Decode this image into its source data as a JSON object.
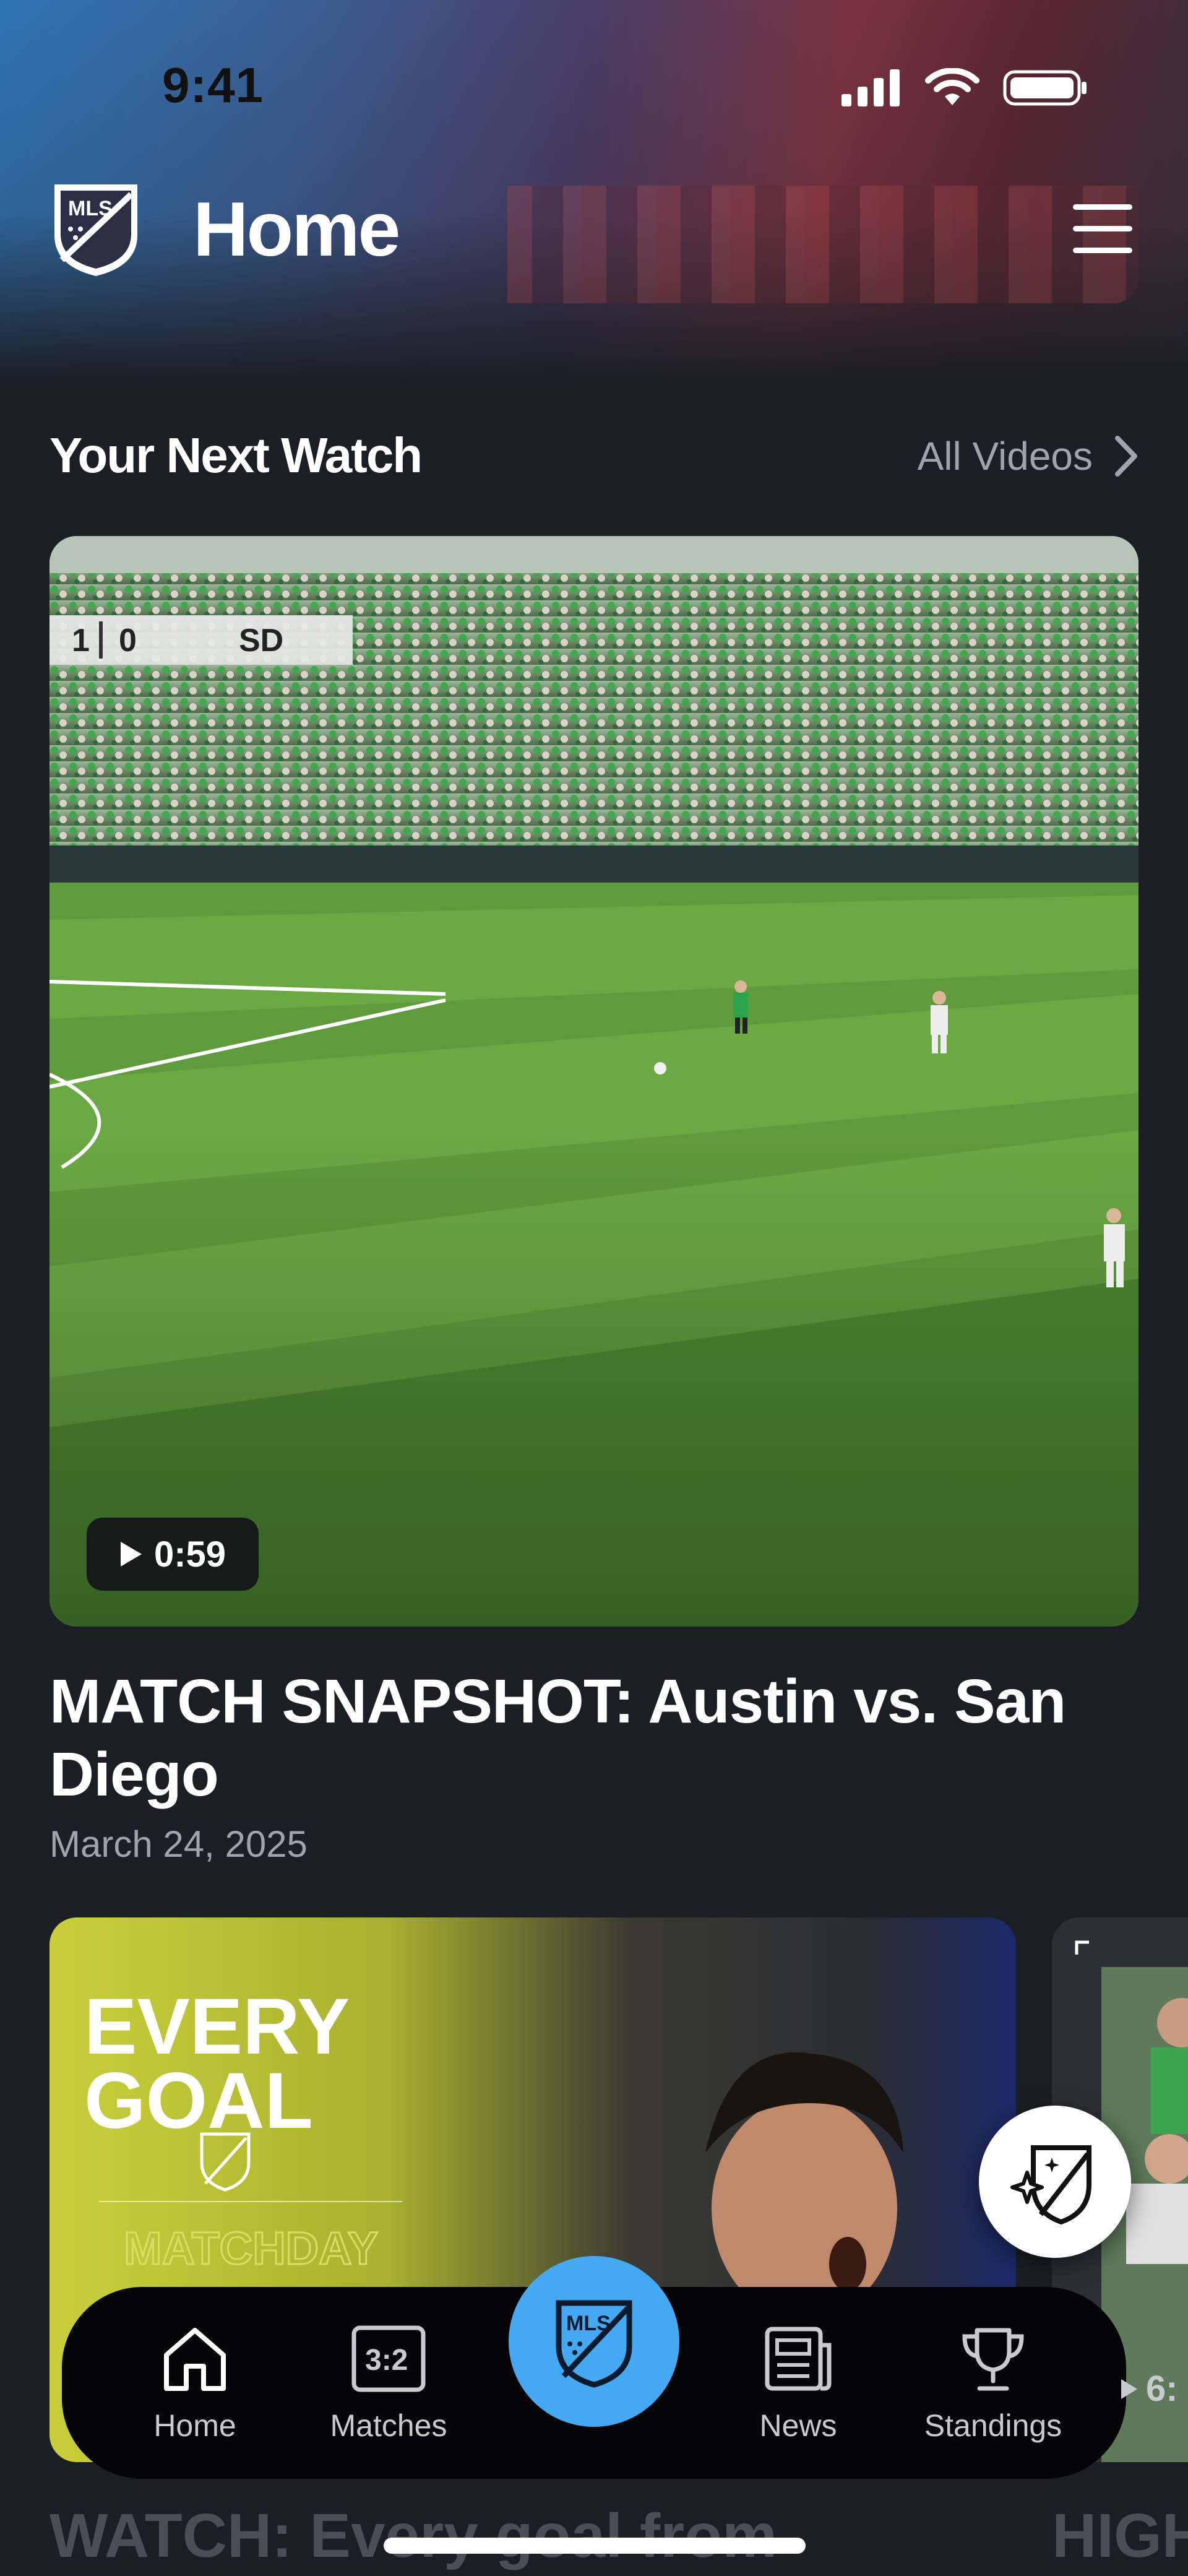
{
  "status_bar": {
    "time": "9:41"
  },
  "header": {
    "title": "Home"
  },
  "section": {
    "title": "Your Next Watch",
    "all_videos_label": "All Videos"
  },
  "featured": {
    "scoreboard": {
      "home_score": "1",
      "away_score": "0",
      "away_team": "SD"
    },
    "duration": "0:59",
    "title": "MATCH SNAPSHOT: Austin vs. San Diego",
    "date": "March 24, 2025"
  },
  "carousel": {
    "card1": {
      "headline_line1": "EVERY",
      "headline_line2": "GOAL",
      "badge": "MATCHDAY",
      "caption": "WATCH: Every goal from"
    },
    "card2": {
      "caption": "HIGH",
      "duration_partial": "6:"
    }
  },
  "tabs": [
    {
      "label": "Home",
      "icon": "house-icon"
    },
    {
      "label": "Matches",
      "icon": "scoreboard-icon",
      "icon_text": "3:2"
    },
    {
      "label": "",
      "icon": "mls-crest-icon"
    },
    {
      "label": "News",
      "icon": "newspaper-icon"
    },
    {
      "label": "Standings",
      "icon": "trophy-icon"
    }
  ],
  "colors": {
    "accent": "#45a9f2",
    "background": "#1b1e25",
    "muted_text": "#9ea3ad"
  }
}
